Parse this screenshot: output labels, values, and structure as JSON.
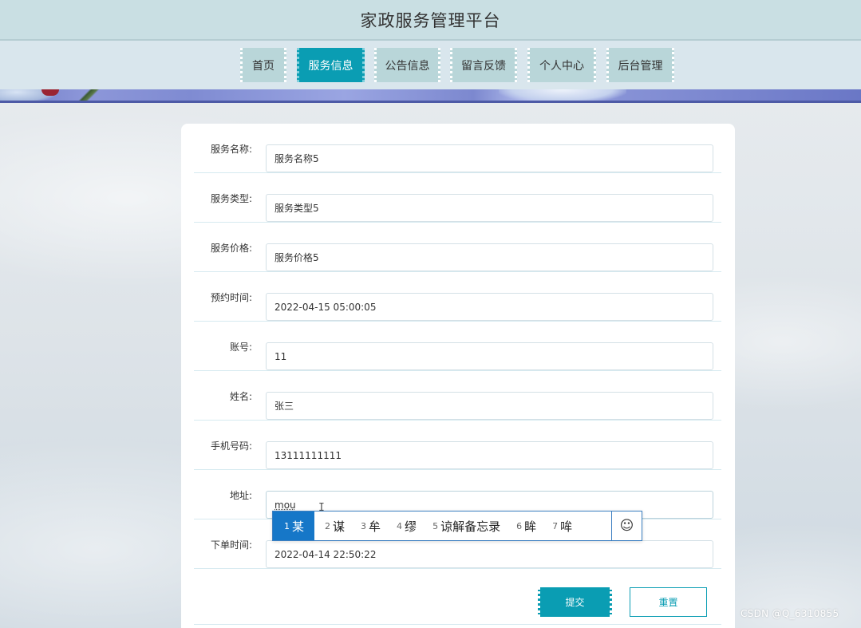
{
  "header": {
    "title": "家政服务管理平台"
  },
  "nav": {
    "items": [
      {
        "label": "首页"
      },
      {
        "label": "服务信息"
      },
      {
        "label": "公告信息"
      },
      {
        "label": "留言反馈"
      },
      {
        "label": "个人中心"
      },
      {
        "label": "后台管理"
      }
    ],
    "active_index": 1
  },
  "form": {
    "fields": [
      {
        "label": "服务名称:",
        "value": "服务名称5"
      },
      {
        "label": "服务类型:",
        "value": "服务类型5"
      },
      {
        "label": "服务价格:",
        "value": "服务价格5"
      },
      {
        "label": "预约时间:",
        "value": "2022-04-15 05:00:05"
      },
      {
        "label": "账号:",
        "value": "11"
      },
      {
        "label": "姓名:",
        "value": "张三"
      },
      {
        "label": "手机号码:",
        "value": "13111111111"
      },
      {
        "label": "地址:",
        "value": "mou"
      },
      {
        "label": "下单时间:",
        "value": "2022-04-14 22:50:22"
      }
    ],
    "submit_label": "提交",
    "reset_label": "重置"
  },
  "ime": {
    "candidates": [
      {
        "num": "1",
        "text": "某"
      },
      {
        "num": "2",
        "text": "谋"
      },
      {
        "num": "3",
        "text": "牟"
      },
      {
        "num": "4",
        "text": "缪"
      },
      {
        "num": "5",
        "text": "谅解备忘录"
      },
      {
        "num": "6",
        "text": "眸"
      },
      {
        "num": "7",
        "text": "哞"
      }
    ],
    "selected_index": 0,
    "emoji_icon": "smiley-icon",
    "emoji_glyph": "☺"
  },
  "text_cursor_glyph": "I",
  "watermark": "CSDN @Q_6310855"
}
